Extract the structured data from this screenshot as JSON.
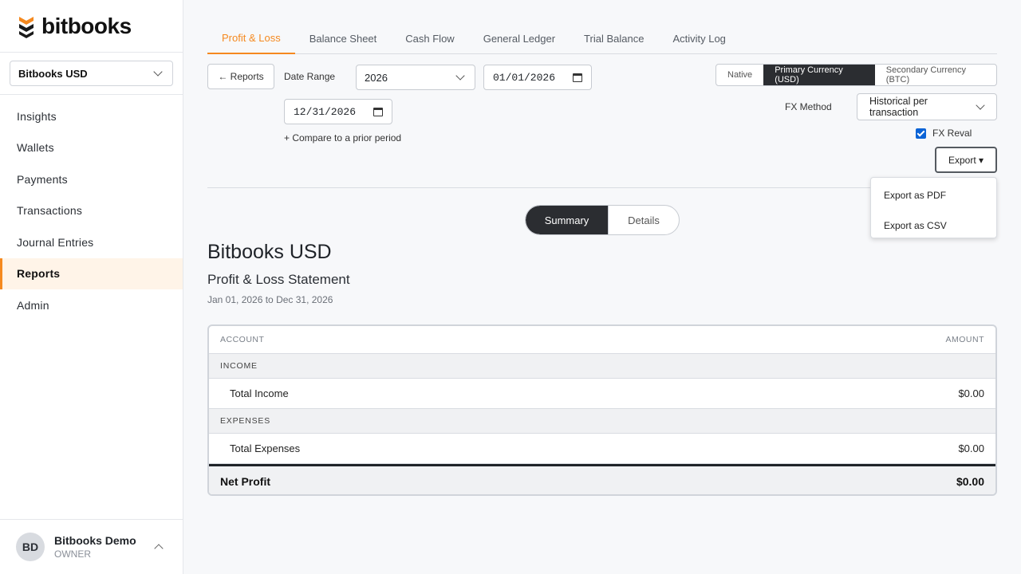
{
  "brand": {
    "name": "bitbooks",
    "accent": "#f5891f"
  },
  "org_selector": {
    "value": "Bitbooks USD"
  },
  "sidebar": {
    "items": [
      {
        "label": "Insights"
      },
      {
        "label": "Wallets"
      },
      {
        "label": "Payments"
      },
      {
        "label": "Transactions"
      },
      {
        "label": "Journal Entries"
      },
      {
        "label": "Reports",
        "active": true
      },
      {
        "label": "Admin"
      }
    ]
  },
  "user": {
    "initials": "BD",
    "name": "Bitbooks Demo",
    "role": "OWNER"
  },
  "tabs": [
    {
      "label": "Profit & Loss",
      "active": true
    },
    {
      "label": "Balance Sheet"
    },
    {
      "label": "Cash Flow"
    },
    {
      "label": "General Ledger"
    },
    {
      "label": "Trial Balance"
    },
    {
      "label": "Activity Log"
    }
  ],
  "controls": {
    "back_label": "← Reports",
    "date_range_label": "Date Range",
    "year_value": "2026",
    "start_date": "01/01/2026",
    "end_date": "12/31/2026",
    "compare_link": "+ Compare to a prior period",
    "currency_options": [
      {
        "label": "Native"
      },
      {
        "label": "Primary Currency (USD)",
        "active": true
      },
      {
        "label": "Secondary Currency (BTC)"
      }
    ],
    "fx_method_label": "FX Method",
    "fx_method_value": "Historical per transaction",
    "fx_reval_label": "FX Reval",
    "fx_reval_checked": true,
    "export_label": "Export ▾",
    "export_menu": [
      "Export as PDF",
      "Export as CSV"
    ]
  },
  "view_toggle": {
    "summary": "Summary",
    "details": "Details",
    "active": "Summary"
  },
  "report": {
    "company": "Bitbooks USD",
    "title": "Profit & Loss Statement",
    "dates": "Jan 01, 2026 to Dec 31, 2026",
    "columns": {
      "account": "ACCOUNT",
      "amount": "AMOUNT"
    },
    "income_header": "INCOME",
    "total_income_label": "Total Income",
    "total_income_value": "$0.00",
    "expenses_header": "EXPENSES",
    "total_expenses_label": "Total Expenses",
    "total_expenses_value": "$0.00",
    "net_profit_label": "Net Profit",
    "net_profit_value": "$0.00"
  }
}
